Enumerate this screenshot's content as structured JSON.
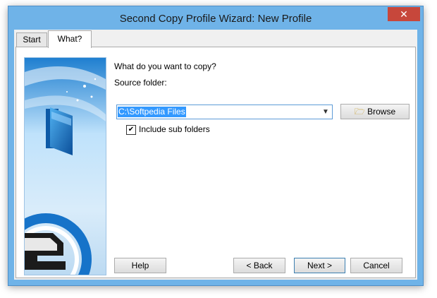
{
  "window": {
    "title": "Second Copy Profile Wizard: New Profile",
    "close_label": "✕"
  },
  "tabs": [
    {
      "label": "Start"
    },
    {
      "label": "What?"
    }
  ],
  "main": {
    "question": "What do you want to copy?",
    "source_label": "Source folder:",
    "source_value": "C:\\Softpedia Files",
    "browse_label": "Browse",
    "include_label": "Include sub folders",
    "include_checked": true
  },
  "buttons": {
    "help": "Help",
    "back": "< Back",
    "next": "Next >",
    "cancel": "Cancel"
  },
  "colors": {
    "title_bar": "#6fb3e8",
    "selection": "#3399ff",
    "close": "#c7473b"
  }
}
